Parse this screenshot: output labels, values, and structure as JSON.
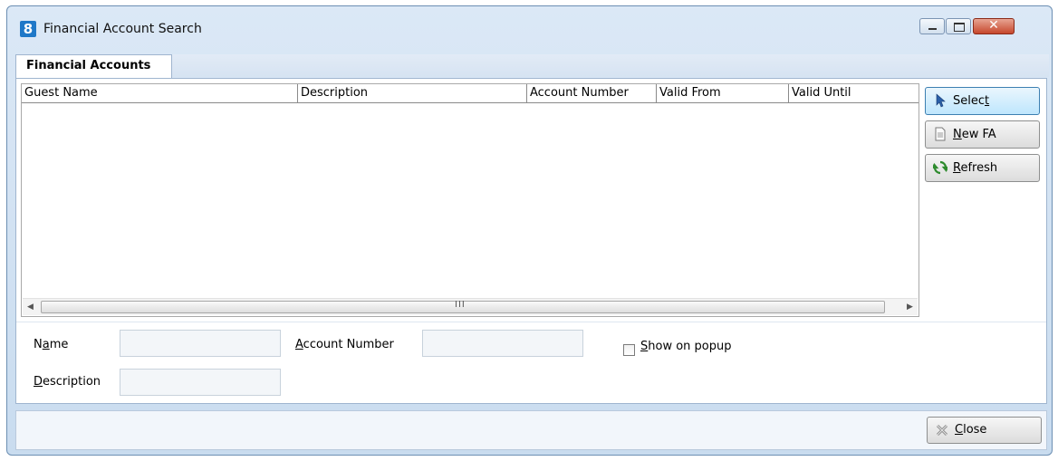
{
  "window": {
    "app_logo": "8",
    "title": "Financial Account Search",
    "controls": [
      "minimize-icon",
      "maximize-icon",
      "close-icon"
    ]
  },
  "tabs": [
    {
      "label": "Financial Accounts",
      "active": true
    }
  ],
  "grid": {
    "columns": [
      "Guest Name",
      "Description",
      "Account Number",
      "Valid From",
      "Valid Until"
    ],
    "rows": [],
    "scrollbar_grip": "III"
  },
  "actions": {
    "select": {
      "pre": "Selec",
      "key": "t",
      "post": "",
      "icon": "cursor-arrow-icon"
    },
    "new_fa": {
      "pre": "",
      "key": "N",
      "post": "ew FA",
      "icon": "document-icon"
    },
    "refresh": {
      "pre": "",
      "key": "R",
      "post": "efresh",
      "icon": "refresh-icon"
    }
  },
  "filters": {
    "name": {
      "pre": "N",
      "key": "a",
      "post": "me",
      "value": ""
    },
    "account_number": {
      "pre": "",
      "key": "A",
      "post": "ccount Number",
      "value": ""
    },
    "description": {
      "pre": "",
      "key": "D",
      "post": "escription",
      "value": ""
    },
    "show_on_popup": {
      "pre": "",
      "key": "S",
      "post": "how on popup",
      "checked": false
    }
  },
  "footer": {
    "close": {
      "pre": "",
      "key": "C",
      "post": "lose",
      "icon": "close-x-icon"
    }
  },
  "colors": {
    "window_frame": "#c9dcef",
    "close_button": "#c6472c",
    "logo": "#1f78c8",
    "select_focus": "#bee6fd"
  }
}
